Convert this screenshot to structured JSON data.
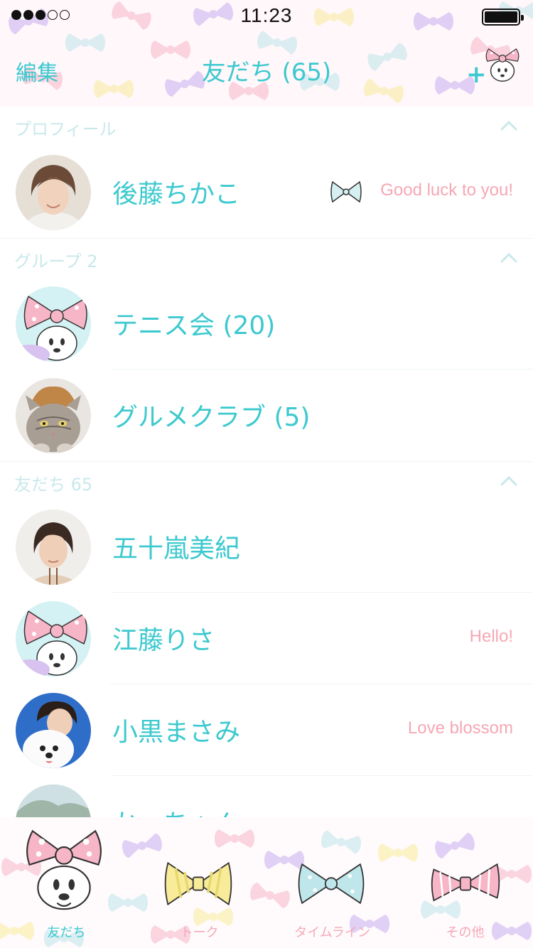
{
  "status_bar": {
    "time": "11:23"
  },
  "nav": {
    "edit_label": "編集",
    "title": "友だち (65)",
    "add_label": "+"
  },
  "sections": [
    {
      "label": "プロフィール",
      "rows": [
        {
          "name": "後藤ちかこ",
          "status": "Good luck to you!",
          "avatar": "woman-short-hair"
        }
      ]
    },
    {
      "label": "グループ 2",
      "rows": [
        {
          "name": "テニス会 (20)",
          "status": "",
          "avatar": "minnie"
        },
        {
          "name": "グルメクラブ (5)",
          "status": "",
          "avatar": "cat"
        }
      ]
    },
    {
      "label": "友だち 65",
      "rows": [
        {
          "name": "五十嵐美紀",
          "status": "",
          "avatar": "woman-bob"
        },
        {
          "name": "江藤りさ",
          "status": "Hello!",
          "avatar": "minnie"
        },
        {
          "name": "小黒まさみ",
          "status": "Love blossom",
          "avatar": "woman-dog"
        },
        {
          "name": "かっちゃん",
          "status": "",
          "avatar": "landscape"
        }
      ]
    }
  ],
  "tabs": [
    {
      "label": "友だち",
      "icon": "minnie-icon",
      "active": true
    },
    {
      "label": "トーク",
      "icon": "yellow-bow-icon",
      "active": false
    },
    {
      "label": "タイムライン",
      "icon": "blue-bow-icon",
      "active": false
    },
    {
      "label": "その他",
      "icon": "pink-bow-icon",
      "active": false
    }
  ],
  "colors": {
    "accent": "#3cc9cf",
    "status_pink": "#f6a7b4",
    "section_label": "#c9e8ea",
    "bow_pink": "#f7b6c8",
    "bow_purple": "#c8aef0",
    "bow_blue": "#bfe6ea",
    "bow_yellow": "#f8ec9a"
  }
}
